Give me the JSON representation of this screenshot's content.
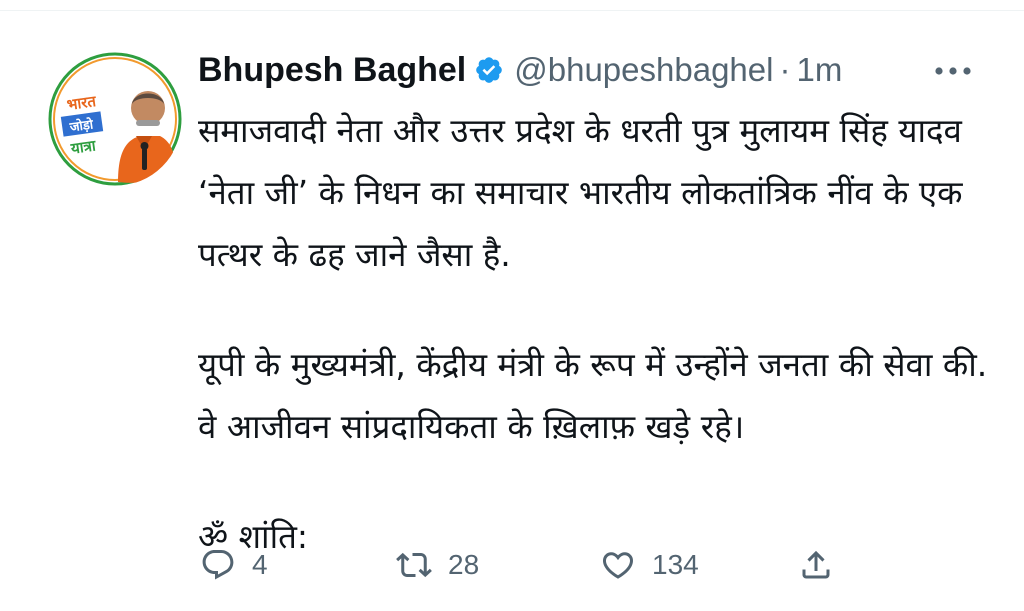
{
  "tweet": {
    "author": {
      "name": "Bhupesh Baghel",
      "handle": "@bhupeshbaghel",
      "separator": "·",
      "timestamp": "1m",
      "avatar_badge": [
        "भारत",
        "जोड़ो",
        "यात्रा"
      ],
      "verified": true
    },
    "paragraphs": [
      "समाजवादी नेता और उत्तर प्रदेश के धरती पुत्र मुलायम सिंह यादव ‘नेता जी’ के निधन का समाचार भारतीय लोकतांत्रिक नींव के एक पत्थर के ढह जाने जैसा है.",
      "यूपी के मुख्यमंत्री, केंद्रीय मंत्री के रूप में उन्होंने जनता की सेवा की. वे आजीवन सांप्रदायिकता के ख़िलाफ़ खड़े रहे।",
      "ॐ शांति:"
    ],
    "actions": {
      "reply": {
        "icon": "reply-icon",
        "count": "4"
      },
      "retweet": {
        "icon": "retweet-icon",
        "count": "28"
      },
      "like": {
        "icon": "heart-icon",
        "count": "134"
      },
      "share": {
        "icon": "share-icon"
      }
    }
  },
  "colors": {
    "text": "#0f1419",
    "secondary": "#536471",
    "verified": "#1d9bf0",
    "avatar_ring": "#2e9e3f",
    "avatar_shirt": "#e8661c"
  }
}
